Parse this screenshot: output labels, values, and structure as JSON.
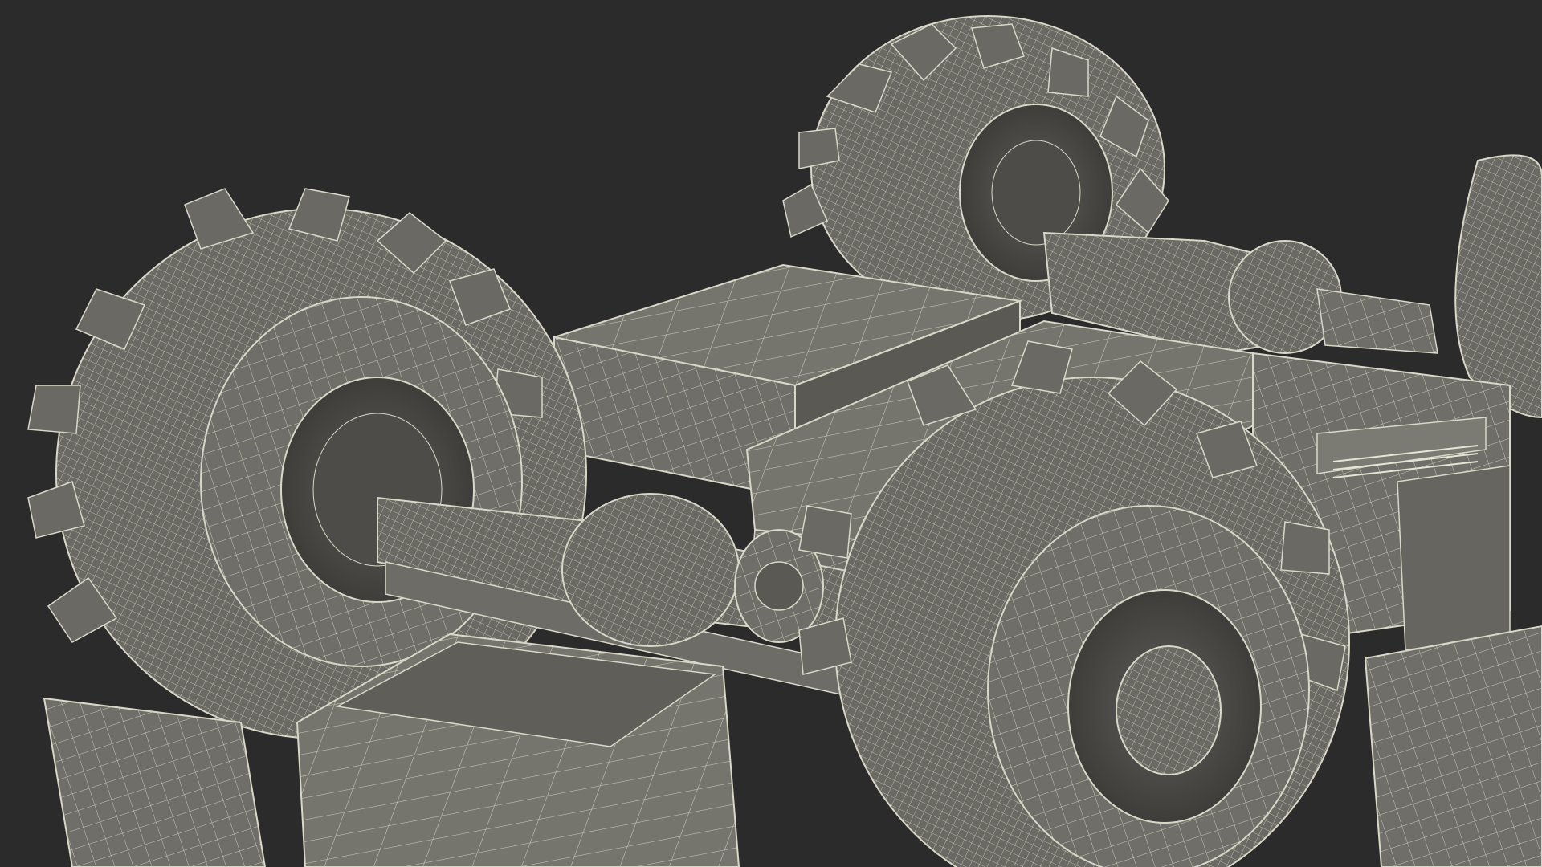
{
  "scene": {
    "background_color": "#2b2b2b",
    "mesh_fill_color": "#6f6e68",
    "mesh_dark_color": "#5a5954",
    "wire_color": "#d9d8c8",
    "shadow_color": "#3e3d3a",
    "components": [
      "front-left-tire",
      "rear-left-tire",
      "front-right-tire",
      "rear-right-tire",
      "front-axle",
      "rear-axle",
      "differential-housing",
      "battery-box",
      "chassis-frame",
      "control-box",
      "front-bumper-plate"
    ]
  }
}
